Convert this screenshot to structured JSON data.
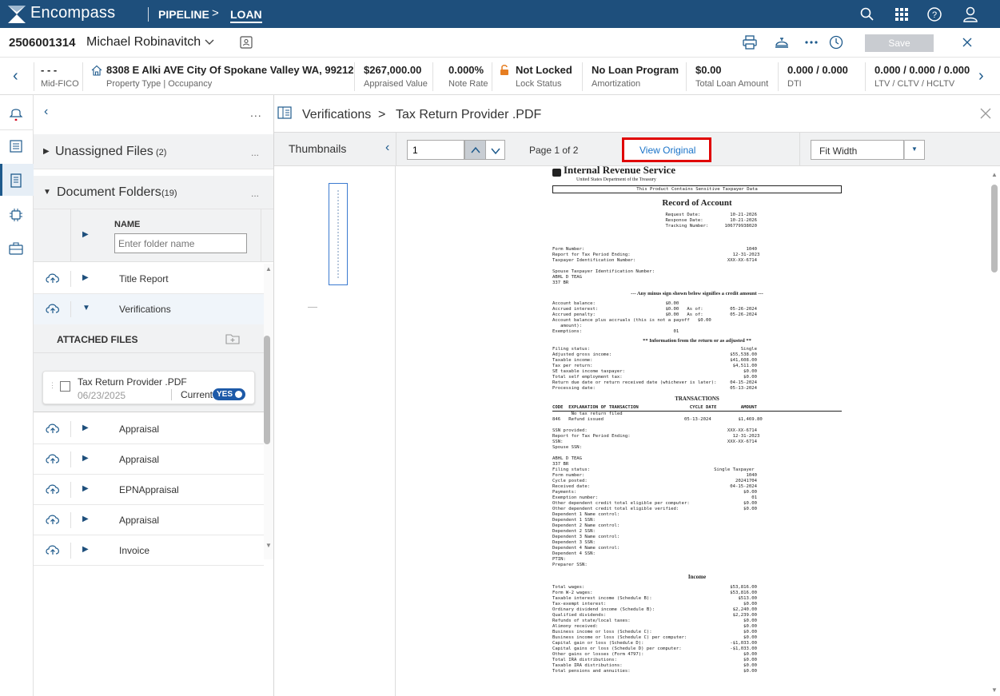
{
  "topbar": {
    "brand": "Encompass",
    "crumb_pipeline": "PIPELINE",
    "crumb_sep": ">",
    "crumb_loan": "LOAN"
  },
  "loan": {
    "number": "2506001314",
    "borrower": "Michael Robinavitch",
    "save_label": "Save"
  },
  "info": {
    "fico": {
      "value": "- - -",
      "label": "Mid-FICO"
    },
    "address": {
      "value": "8308 E Alki AVE City Of Spokane Valley WA, 99212",
      "label": "Property Type | Occupancy"
    },
    "appraised": {
      "value": "$267,000.00",
      "label": "Appraised Value"
    },
    "rate": {
      "value": "0.000%",
      "label": "Note Rate"
    },
    "lock": {
      "value": "Not Locked",
      "label": "Lock Status"
    },
    "amort": {
      "value": "No Loan Program",
      "label": "Amortization"
    },
    "total": {
      "value": "$0.00",
      "label": "Total Loan Amount"
    },
    "dti": {
      "value": "0.000 / 0.000",
      "label": "DTI"
    },
    "ltv": {
      "value": "0.000 / 0.000 / 0.000",
      "label": "LTV / CLTV / HCLTV"
    }
  },
  "panel": {
    "unassigned": "Unassigned Files",
    "unassigned_count": "(2)",
    "folders": "Document Folders",
    "folders_count": "(19)",
    "name_header": "NAME",
    "name_placeholder": "Enter folder name",
    "attached_files": "ATTACHED FILES",
    "rows": [
      "Title Report",
      "Verifications",
      "Appraisal",
      "Appraisal",
      "EPNAppraisal",
      "Appraisal",
      "Invoice"
    ],
    "file": {
      "name": "Tax Return Provider .PDF",
      "date": "06/23/2025",
      "current_label": "Current",
      "toggle": "YES"
    }
  },
  "viewer": {
    "crumb_folder": "Verifications",
    "crumb_sep": ">",
    "crumb_file": "Tax Return Provider .PDF",
    "thumbnails": "Thumbnails",
    "page_input": "1",
    "page_info": "Page 1 of 2",
    "view_original": "View Original",
    "fit": "Fit Width"
  },
  "colors": {
    "brand": "#1e4f7c",
    "accent": "#1a73c8",
    "highlight": "#e00000",
    "lock": "#e67e22"
  },
  "document": {
    "agency": "Internal Revenue Service",
    "dept": "United States Department of the Treasury",
    "banner": "This Product Contains Sensitive Taxpayer Data",
    "title": "Record of Account",
    "meta_lines": [
      "                                          Request Date:           10-21-2026",
      "                                          Response Date:          10-21-2026",
      "                                          Tracking Number:      106779938020"
    ],
    "lines_a": [
      "Form Number:                                                            1040",
      "Report for Tax Period Ending:                                      12-31-2023",
      "Taxpayer Identification Number:                                  XXX-XX-6714",
      "",
      "Spouse Taxpayer Identification Number:",
      "ABHL D TEAG",
      "337 BR"
    ],
    "minus_note": "--- Any minus sign shown below signifies a credit amount ---",
    "lines_b": [
      "Account balance:                          $0.00",
      "Accrued interest:                         $0.00   As of:          05-26-2024",
      "Accrued penalty:                          $0.00   As of:          05-26-2024",
      "Account balance plus accruals (this is not a payoff   $0.00",
      "   amount):",
      "Exemptions:                                  01"
    ],
    "info_note": "** Information from the return or as adjusted **",
    "lines_c": [
      "Filing status:                                                        Single",
      "Adjusted gross income:                                            $55,538.00",
      "Taxable income:                                                   $41,608.00",
      "Tax per return:                                                    $4,511.00",
      "SE taxable income taxpayer:                                            $0.00",
      "Total self employment tax:                                             $0.00",
      "Return due date or return received date (whichever is later):     04-15-2024",
      "Processing date:                                                  05-13-2024"
    ],
    "transactions": "TRANSACTIONS",
    "tx_header": "CODE  EXPLANATION OF TRANSACTION                   CYCLE DATE         AMOUNT",
    "lines_d": [
      "       No tax return filed",
      "846   Refund issued                              05-13-2024          $1,469.80",
      "",
      "SSN provided:                                                    XXX-XX-6714",
      "Report for Tax Period Ending:                                      12-31-2023",
      "SSN:                                                             XXX-XX-6714",
      "Spouse SSN:",
      "",
      "ABHL D TEAG",
      "337 BR",
      "Filing status:                                              Single Taxpayer",
      "Form number:                                                            1040",
      "Cycle posted:                                                       20241704",
      "Received date:                                                    04-15-2024",
      "Payments:                                                              $0.00",
      "Exemption number:                                                         01",
      "Other dependent credit total eligible per computer:                    $0.00",
      "Other dependent credit total eligible verified:                        $0.00",
      "Dependent 1 Name control:",
      "Dependent 1 SSN:",
      "Dependent 2 Name control:",
      "Dependent 2 SSN:",
      "Dependent 3 Name control:",
      "Dependent 3 SSN:",
      "Dependent 4 Name control:",
      "Dependent 4 SSN:",
      "PTIN:",
      "Preparer SSN:"
    ],
    "income": "Income",
    "lines_e": [
      "Total wages:                                                      $53,816.00",
      "Form W-2 wages:                                                   $53,816.00",
      "Taxable interest income (Schedule B):                                $513.00",
      "Tax-exempt interest:                                                   $0.00",
      "Ordinary dividend income (Schedule B):                             $2,240.00",
      "Qualified dividends:                                               $2,239.00",
      "Refunds of state/local taxes:                                          $0.00",
      "Alimony received:                                                      $0.00",
      "Business income or loss (Schedule C):                                  $0.00",
      "Business income or loss (Schedule C) per computer:                     $0.00",
      "Capital gain or loss (Schedule D):                                -$1,033.00",
      "Capital gains or loss (Schedule D) per computer:                  -$1,033.00",
      "Other gains or losses (Form 4797):                                     $0.00",
      "Total IRA distributions:                                               $0.00",
      "Taxable IRA distributions:                                             $0.00",
      "Total pensions and annuities:                                          $0.00"
    ]
  }
}
